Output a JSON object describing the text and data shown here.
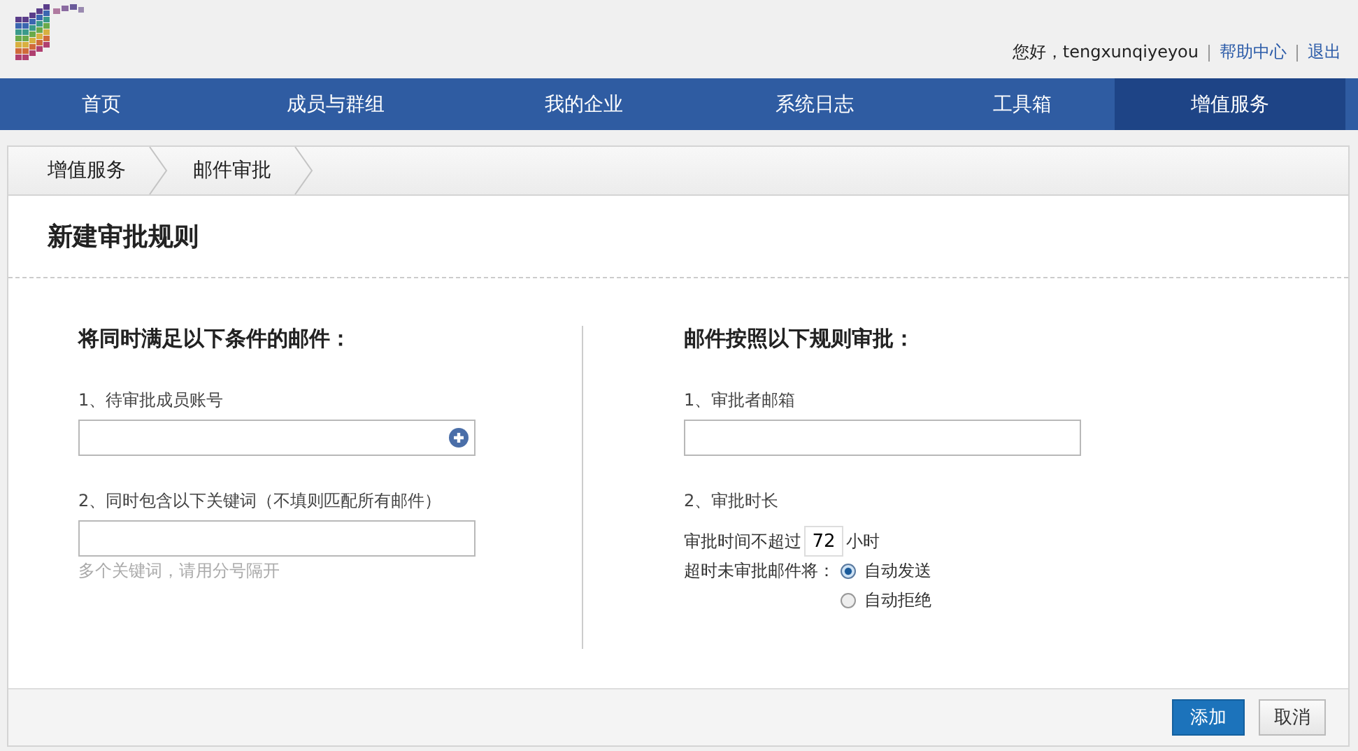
{
  "header": {
    "greeting": "您好，tengxunqiyeyou",
    "links": [
      "帮助中心",
      "退出"
    ]
  },
  "nav": [
    {
      "label": "首页",
      "selected": false
    },
    {
      "label": "成员与群组",
      "selected": false
    },
    {
      "label": "我的企业",
      "selected": false
    },
    {
      "label": "系统日志",
      "selected": false
    },
    {
      "label": "工具箱",
      "selected": false
    },
    {
      "label": "增值服务",
      "selected": true
    }
  ],
  "breadcrumb": [
    "增值服务",
    "邮件审批"
  ],
  "title": "新建审批规则",
  "left": {
    "heading": "将同时满足以下条件的邮件：",
    "account_label": "1、待审批成员账号",
    "keyword_label": "2、同时包含以下关键词（不填则匹配所有邮件）",
    "keyword_hint": "多个关键词，请用分号隔开"
  },
  "right": {
    "heading": "邮件按照以下规则审批：",
    "approver_label": "1、审批者邮箱",
    "duration_label": "2、审批时长",
    "limit_prefix": "审批时间不超过",
    "hours": "72",
    "limit_suffix": "小时",
    "timeout_label": "超时未审批邮件将：",
    "options": [
      {
        "label": "自动发送",
        "selected": true
      },
      {
        "label": "自动拒绝",
        "selected": false
      }
    ]
  },
  "buttons": {
    "add": "添加",
    "cancel": "取消"
  }
}
